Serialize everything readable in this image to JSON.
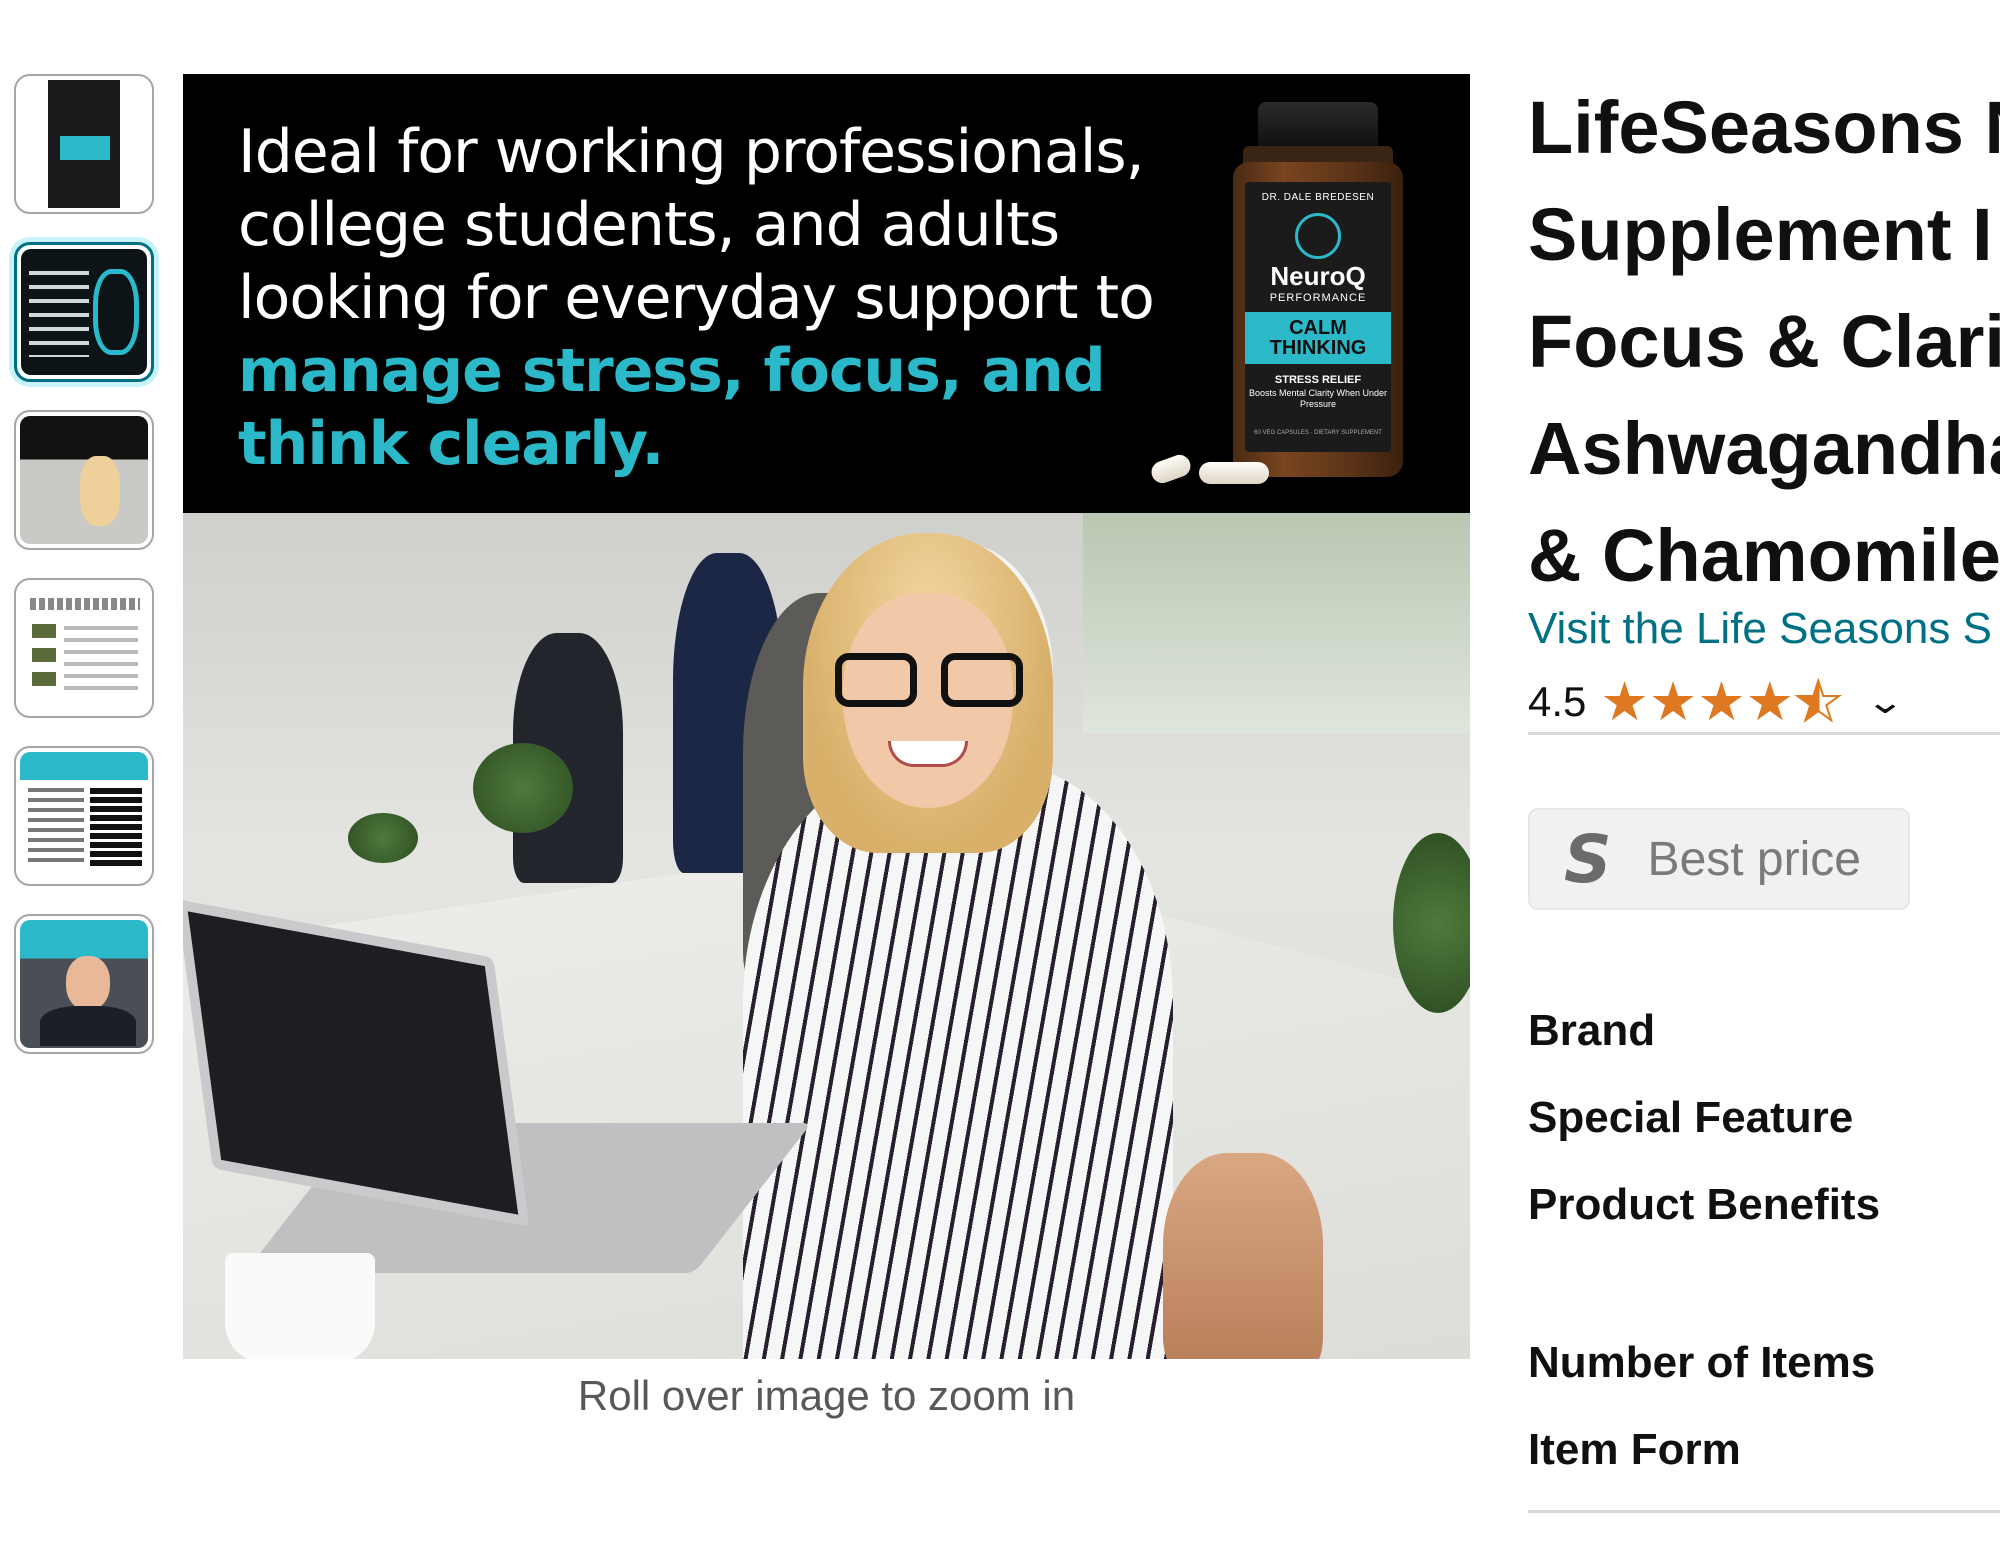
{
  "thumbnails": [
    {
      "label": "Product bottle"
    },
    {
      "label": "Benefits infographic"
    },
    {
      "label": "Lifestyle office image"
    },
    {
      "label": "Ingredients chart"
    },
    {
      "label": "Supplement facts"
    },
    {
      "label": "Doctor video"
    }
  ],
  "banner": {
    "line1": "Ideal for working professionals,",
    "line2": "college students, and adults",
    "line3": "looking for everyday support to",
    "accent1": "manage stress, focus, and",
    "accent2": "think clearly."
  },
  "bottle": {
    "top_text": "DR. DALE BREDESEN",
    "brand": "NeuroQ",
    "performance": "PERFORMANCE",
    "calm_line1": "CALM",
    "calm_line2": "THINKING",
    "stress": "STRESS RELIEF",
    "boosts": "Boosts Mental Clarity When Under Pressure",
    "foot": "60 VEG CAPSULES · DIETARY SUPPLEMENT"
  },
  "zoom_hint": "Roll over image to zoom in",
  "product": {
    "title_lines": [
      "LifeSeasons N",
      "Supplement I",
      "Focus & Clarit",
      "Ashwagandha",
      "& Chamomile"
    ],
    "store_link": "Visit the Life Seasons S",
    "rating": "4.5",
    "rating_icon": "chevron-down-icon"
  },
  "best_price": {
    "logo": "S",
    "label": "Best price"
  },
  "specs": [
    "Brand",
    "Special Feature",
    "Product Benefits",
    "Number of Items",
    "Item Form"
  ],
  "colors": {
    "accent": "#2bb8c8",
    "link": "#007185",
    "star": "#de7921"
  }
}
